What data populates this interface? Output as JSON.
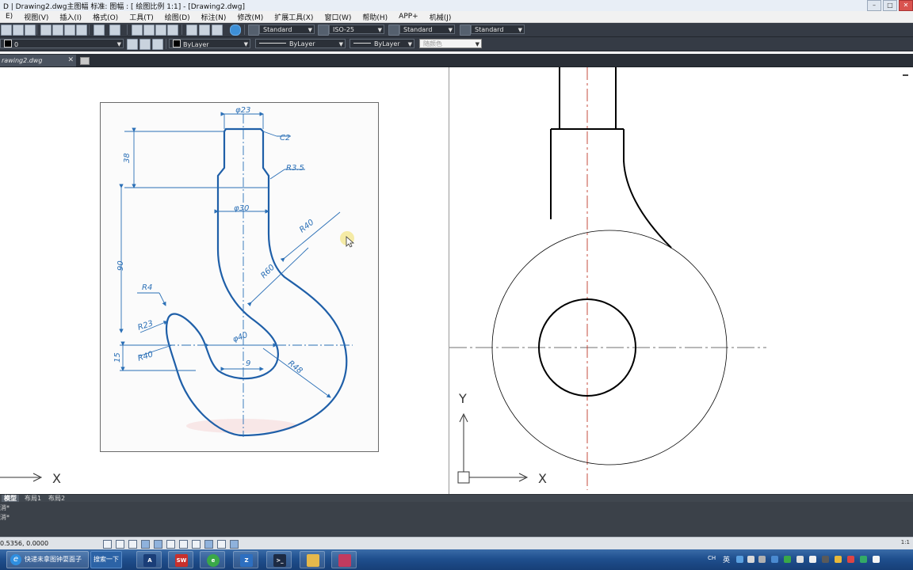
{
  "window": {
    "title": "D | Drawing2.dwg主图幅  标准: 图幅 : [ 绘图比例 1:1] - [Drawing2.dwg]",
    "controls": [
      "–",
      "□",
      "✕"
    ]
  },
  "menu": [
    "E)",
    "视图(V)",
    "插入(I)",
    "格式(O)",
    "工具(T)",
    "绘图(D)",
    "标注(N)",
    "修改(M)",
    "扩展工具(X)",
    "窗口(W)",
    "帮助(H)",
    "APP+",
    "机械(J)"
  ],
  "toolbar1": {
    "text_style": "Standard",
    "dim_style": "ISO-25",
    "table_style": "Standard",
    "multileader_style": "Standard"
  },
  "toolbar2": {
    "layer": "0",
    "color": "ByLayer",
    "linetype": "ByLayer",
    "lineweight": "ByLayer",
    "plotstyle": "随颜色"
  },
  "file_tab": {
    "label": "rawing2.dwg",
    "close": "✕"
  },
  "reference_drawing": {
    "labels": {
      "phi23": "φ23",
      "c2": "C2",
      "d38": "38",
      "r35": "R3.5",
      "phi30": "φ30",
      "r40_top": "R40",
      "r60": "R60",
      "d90": "90",
      "r4": "R4",
      "r23": "R23",
      "phi40": "φ40",
      "r40_left": "R40",
      "d15": "15",
      "d9": "9",
      "r48": "R48"
    }
  },
  "ucs": {
    "x_label": "X",
    "y_label": "Y"
  },
  "layout_tabs": [
    "模型",
    "布局1",
    "布局2"
  ],
  "command_lines": [
    "消*",
    "消*"
  ],
  "status": {
    "coordinates": "0.5356, 0.0000",
    "annotation_scale": "1:1"
  },
  "taskbar": {
    "ie_label": "快递未拿图钟耍面子",
    "search_label": "搜索一下",
    "apps": [
      {
        "icon": "autocad-icon",
        "label": "A"
      },
      {
        "icon": "solidworks-icon",
        "label": "SW"
      },
      {
        "icon": "browser-icon",
        "label": "e"
      },
      {
        "icon": "cad-tool-icon",
        "label": "Z"
      },
      {
        "icon": "terminal-icon",
        "label": ">_"
      },
      {
        "icon": "folder-icon",
        "label": ""
      },
      {
        "icon": "media-icon",
        "label": ""
      }
    ],
    "tray_lang": "英",
    "tray_ch": "CH"
  },
  "colors": {
    "reference_blue": "#1f5fa8",
    "centerline_red": "#c0392b",
    "toolbar_dark": "#353b45",
    "taskbar_blue": "#1f4f8e"
  }
}
